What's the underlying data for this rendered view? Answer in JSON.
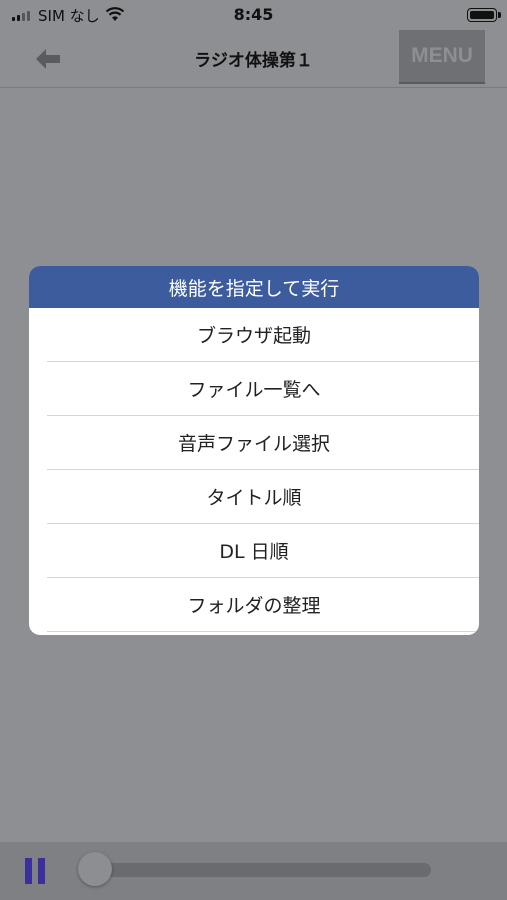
{
  "status_bar": {
    "carrier": "SIM なし",
    "time": "8:45"
  },
  "nav": {
    "title": "ラジオ体操第１",
    "menu_label": "MENU",
    "back_icon": "back-arrow-icon"
  },
  "dialog": {
    "title": "機能を指定して実行",
    "items": [
      {
        "label": "ブラウザ起動"
      },
      {
        "label": "ファイル一覧へ"
      },
      {
        "label": "音声ファイル選択"
      },
      {
        "label": "タイトル順"
      },
      {
        "label": "DL 日順"
      },
      {
        "label": "フォルダの整理"
      }
    ]
  },
  "player": {
    "pause_icon": "pause-icon",
    "progress": 0
  },
  "colors": {
    "background": "#8e8f93",
    "dialog_header": "#3c5c9e",
    "menu_button": "#6f7073",
    "pause": "#3a2f9c"
  }
}
